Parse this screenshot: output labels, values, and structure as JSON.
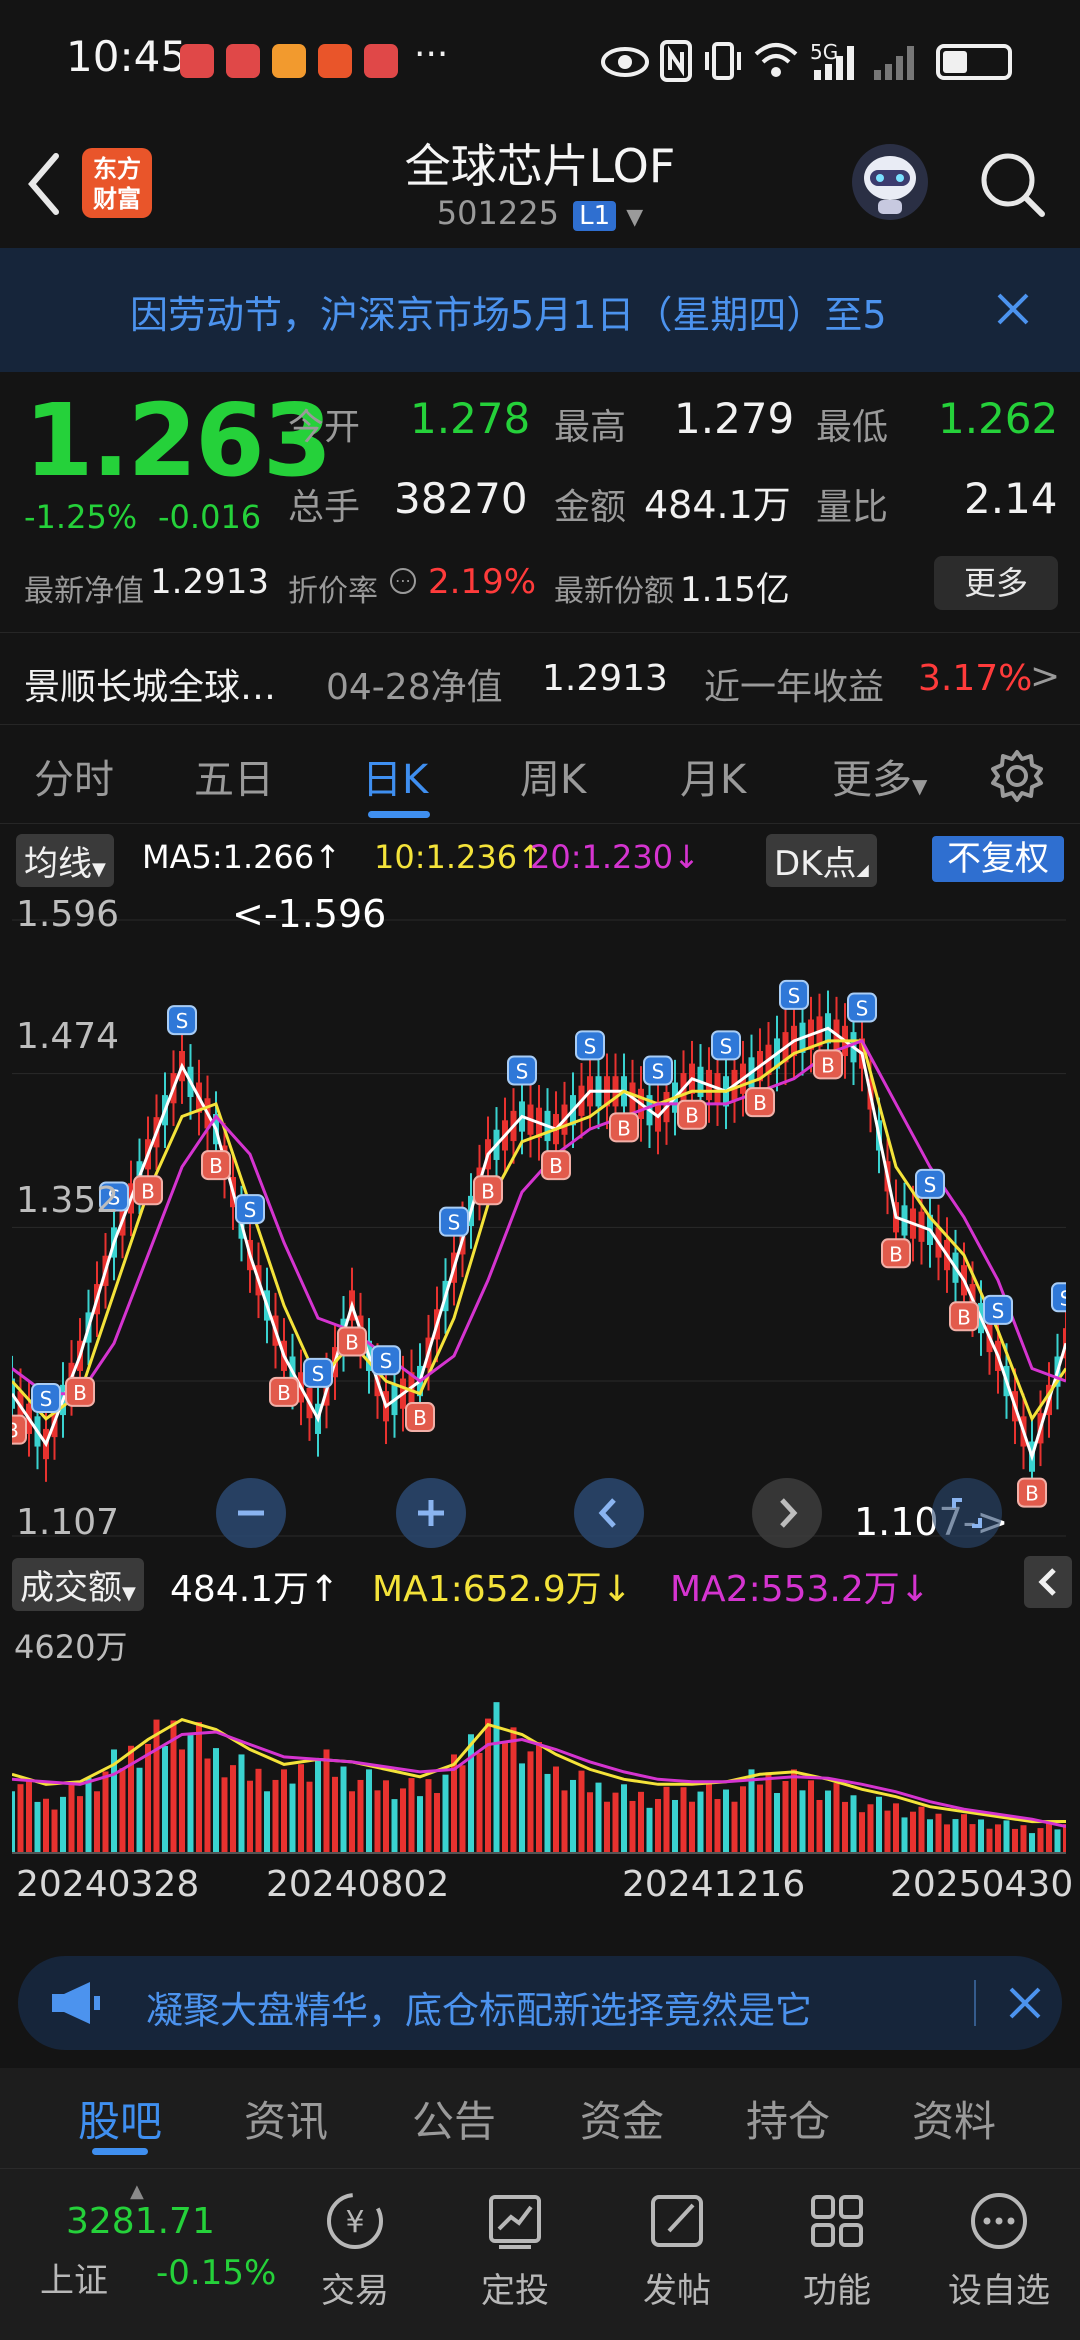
{
  "status_bar": {
    "time": "10:45",
    "more_dots": "···",
    "network": "5G",
    "notification_colors": [
      "#e04848",
      "#e04848",
      "#f29a2e",
      "#e9552a",
      "#e04848"
    ]
  },
  "header": {
    "title": "全球芯片LOF",
    "code": "501225",
    "market_badge": "L1",
    "brand_line1": "东方",
    "brand_line2": "财富",
    "back_icon": "chevron-left-icon",
    "search_icon": "search-icon"
  },
  "notice": {
    "text": "因劳动节，沪深京市场5月1日（星期四）至5",
    "close_icon": "close-icon"
  },
  "quote": {
    "price": "1.263",
    "change_pct": "-1.25%",
    "change": "-0.016",
    "open_label": "今开",
    "open": "1.278",
    "high_label": "最高",
    "high": "1.279",
    "low_label": "最低",
    "low": "1.262",
    "volume_label": "总手",
    "volume": "38270",
    "amount_label": "金额",
    "amount": "484.1万",
    "ratio_label": "量比",
    "ratio": "2.14",
    "nav_label": "最新净值",
    "nav": "1.2913",
    "discount_label": "折价率",
    "discount": "2.19%",
    "shares_label": "最新份额",
    "shares": "1.15亿",
    "more_button": "更多",
    "fund_name": "景顺长城全球…",
    "nav_date_label": "04-28净值",
    "nav_date_value": "1.2913",
    "yearly_label": "近一年收益",
    "yearly_value": "3.17%",
    "colors": {
      "up": "#ff3b3b",
      "down": "#25d13a"
    }
  },
  "period_tabs": {
    "items": [
      "分时",
      "五日",
      "日K",
      "周K",
      "月K",
      "更多"
    ],
    "active": "日K",
    "settings_icon": "gear-icon"
  },
  "indicator": {
    "selector": "均线",
    "ma5": "MA5:1.266",
    "ma10": "10:1.236",
    "ma20": "20:1.230",
    "dk_button": "DK点",
    "adjust_button": "不复权",
    "colors": {
      "ma5": "#ffffff",
      "ma10": "#f4e33a",
      "ma20": "#d534d0"
    }
  },
  "kline": {
    "axis_top": "1.596",
    "axis_mid1": "1.474",
    "axis_mid2": "1.352",
    "axis_bottom": "1.107",
    "max_marker": "<-1.596",
    "min_marker": "1.107->",
    "zoom_out_icon": "minus-icon",
    "zoom_in_icon": "plus-icon",
    "prev_icon": "chevron-left-icon",
    "next_icon": "chevron-right-icon",
    "expand_icon": "expand-icon"
  },
  "volume": {
    "selector": "成交额",
    "current": "484.1万",
    "ma1": "MA1:652.9万",
    "ma2": "MA2:553.2万",
    "axis_max": "4620万",
    "collapse_icon": "chevron-left-icon",
    "colors": {
      "ma1": "#f4e33a",
      "ma2": "#d534d0",
      "up": "#e8322f",
      "down": "#3ad3d0"
    }
  },
  "dates": [
    "20240328",
    "20240802",
    "20241216",
    "20250430"
  ],
  "chart_data": [
    {
      "type": "line",
      "title": "日K",
      "ylim": [
        1.107,
        1.596
      ],
      "x": [
        "20240328",
        "20240802",
        "20241216",
        "20250430"
      ],
      "series": [
        {
          "name": "MA5",
          "values": [
            1.22,
            1.18,
            1.25,
            1.34,
            1.41,
            1.48,
            1.43,
            1.33,
            1.25,
            1.2,
            1.29,
            1.21,
            1.23,
            1.32,
            1.41,
            1.44,
            1.43,
            1.46,
            1.46,
            1.44,
            1.47,
            1.46,
            1.48,
            1.5,
            1.51,
            1.49,
            1.36,
            1.35,
            1.31,
            1.25,
            1.17,
            1.26
          ]
        },
        {
          "name": "MA10",
          "values": [
            1.23,
            1.2,
            1.22,
            1.3,
            1.38,
            1.44,
            1.45,
            1.37,
            1.29,
            1.23,
            1.26,
            1.23,
            1.22,
            1.28,
            1.37,
            1.42,
            1.43,
            1.44,
            1.46,
            1.45,
            1.46,
            1.46,
            1.47,
            1.49,
            1.5,
            1.5,
            1.4,
            1.36,
            1.33,
            1.27,
            1.2,
            1.24
          ]
        },
        {
          "name": "MA20",
          "values": [
            1.24,
            1.22,
            1.22,
            1.26,
            1.33,
            1.4,
            1.44,
            1.41,
            1.34,
            1.28,
            1.27,
            1.25,
            1.23,
            1.25,
            1.31,
            1.38,
            1.41,
            1.43,
            1.44,
            1.45,
            1.45,
            1.45,
            1.46,
            1.47,
            1.49,
            1.5,
            1.45,
            1.4,
            1.36,
            1.31,
            1.24,
            1.23
          ]
        }
      ]
    },
    {
      "type": "bar",
      "title": "成交额",
      "ylim": [
        0,
        4620
      ],
      "ylabel": "万",
      "x": [
        "20240328",
        "20240802",
        "20241216",
        "20250430"
      ],
      "series": [
        {
          "name": "成交额",
          "values": [
            1800,
            1200,
            1500,
            2100,
            2600,
            3000,
            2300,
            1900,
            1700,
            2200,
            1800,
            1600,
            1500,
            2000,
            3200,
            2600,
            1900,
            1600,
            1400,
            1300,
            1500,
            1400,
            1800,
            1700,
            1500,
            1200,
            1100,
            900,
            800,
            700,
            600,
            650
          ]
        },
        {
          "name": "MA1",
          "values": [
            1600,
            1400,
            1450,
            1800,
            2300,
            2700,
            2500,
            2100,
            1800,
            1900,
            1850,
            1700,
            1550,
            1800,
            2600,
            2400,
            2000,
            1700,
            1500,
            1400,
            1400,
            1450,
            1600,
            1650,
            1500,
            1300,
            1150,
            950,
            850,
            750,
            650,
            653
          ]
        },
        {
          "name": "MA2",
          "values": [
            1500,
            1450,
            1400,
            1600,
            2000,
            2400,
            2450,
            2200,
            1950,
            1900,
            1850,
            1750,
            1650,
            1700,
            2200,
            2300,
            2100,
            1850,
            1650,
            1500,
            1450,
            1450,
            1500,
            1550,
            1520,
            1400,
            1250,
            1050,
            900,
            800,
            700,
            553
          ]
        }
      ]
    }
  ],
  "ad": {
    "text": "凝聚大盘精华，底仓标配新选择竟然是它",
    "megaphone_icon": "megaphone-icon",
    "close_icon": "close-icon"
  },
  "content_tabs": {
    "items": [
      "股吧",
      "资讯",
      "公告",
      "资金",
      "持仓",
      "资料"
    ],
    "active": "股吧"
  },
  "bottom_nav": {
    "index_name": "上证",
    "index_value": "3281.71",
    "index_change": "-0.15%",
    "items": [
      {
        "label": "交易",
        "icon": "trade-icon"
      },
      {
        "label": "定投",
        "icon": "invest-icon"
      },
      {
        "label": "发帖",
        "icon": "post-icon"
      },
      {
        "label": "功能",
        "icon": "grid-icon"
      },
      {
        "label": "设自选",
        "icon": "more-icon"
      }
    ]
  }
}
